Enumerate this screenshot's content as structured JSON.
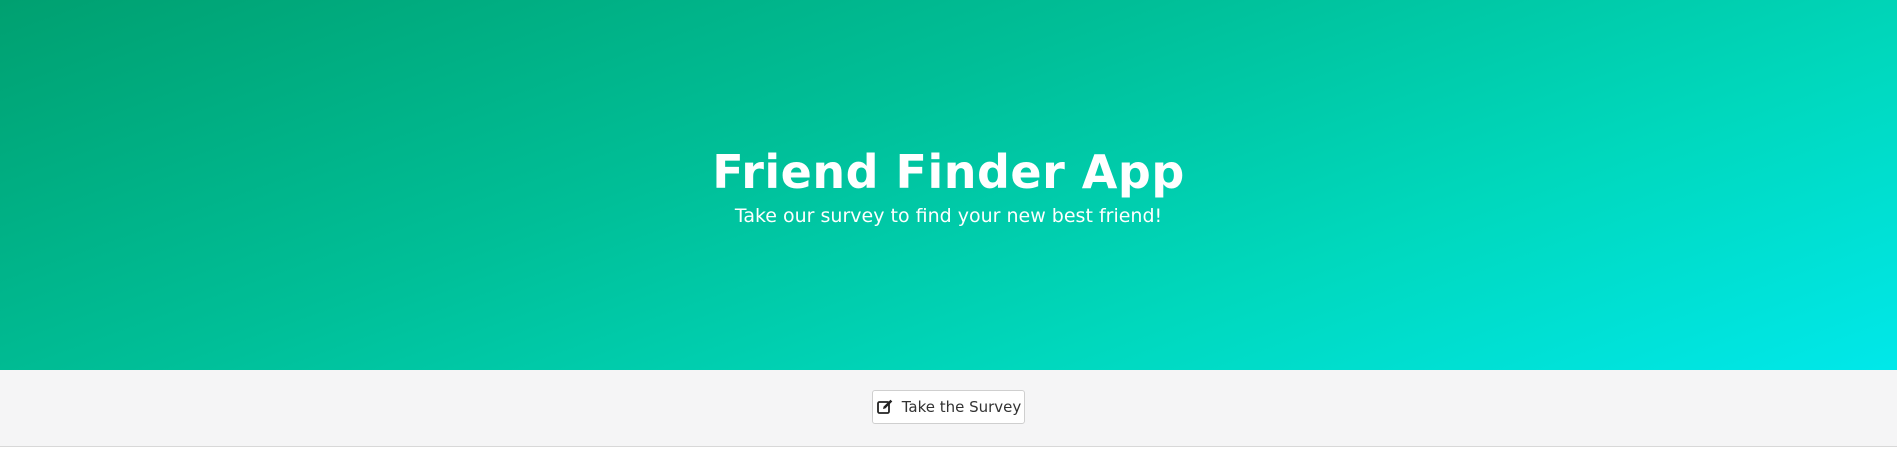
{
  "hero": {
    "title": "Friend Finder App",
    "subtitle": "Take our survey to find your new best friend!",
    "gradient_colors": [
      "#00a070",
      "#00bf98",
      "#00d8bd",
      "#00e8ea"
    ]
  },
  "footer": {
    "survey_button": {
      "label": "Take the Survey",
      "icon": "edit-icon"
    },
    "background": "#f5f5f6"
  }
}
